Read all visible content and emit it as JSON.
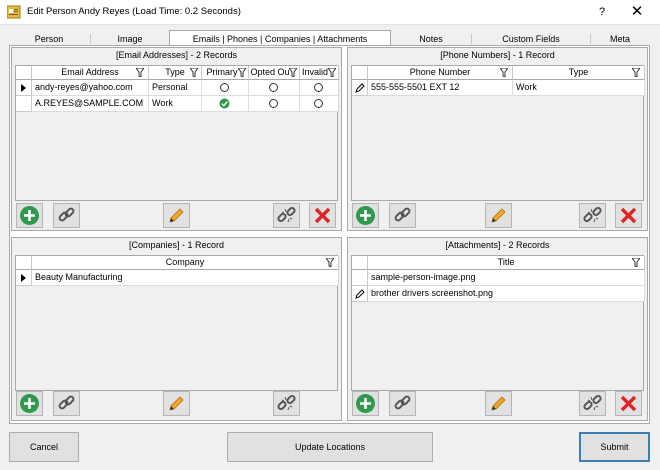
{
  "window": {
    "title": "Edit Person Andy Reyes (Load Time: 0.2 Seconds)",
    "help": "?",
    "close": "✕"
  },
  "tabs": [
    "Person",
    "Image",
    "Emails | Phones | Companies | Attachments",
    "Notes",
    "Custom Fields",
    "Meta"
  ],
  "emails": {
    "title": "[Email Addresses] - 2 Records",
    "columns": [
      "Email Address",
      "Type",
      "Primary",
      "Opted Ou",
      "Invalid"
    ],
    "rows": [
      {
        "email": "andy-reyes@yahoo.com",
        "type": "Personal",
        "primary": false,
        "opted_out": false,
        "invalid": false
      },
      {
        "email": "A.REYES@SAMPLE.COM",
        "type": "Work",
        "primary": true,
        "opted_out": false,
        "invalid": false
      }
    ]
  },
  "phones": {
    "title": "[Phone Numbers] - 1 Record",
    "columns": [
      "Phone Number",
      "Type"
    ],
    "rows": [
      {
        "number": "555-555-5501 EXT 12",
        "type": "Work"
      }
    ]
  },
  "companies": {
    "title": "[Companies] - 1 Record",
    "columns": [
      "Company"
    ],
    "rows": [
      {
        "name": "Beauty Manufacturing"
      }
    ]
  },
  "attachments": {
    "title": "[Attachments] - 2 Records",
    "columns": [
      "Title"
    ],
    "rows": [
      {
        "title": "sample-person-image.png"
      },
      {
        "title": "brother drivers screenshot.png"
      }
    ]
  },
  "footer": {
    "cancel": "Cancel",
    "update": "Update Locations",
    "submit": "Submit"
  },
  "colors": {
    "accent": "#3c7fb1",
    "add": "#2e9a4e",
    "delete": "#e02424",
    "edit": "#f5a623"
  }
}
